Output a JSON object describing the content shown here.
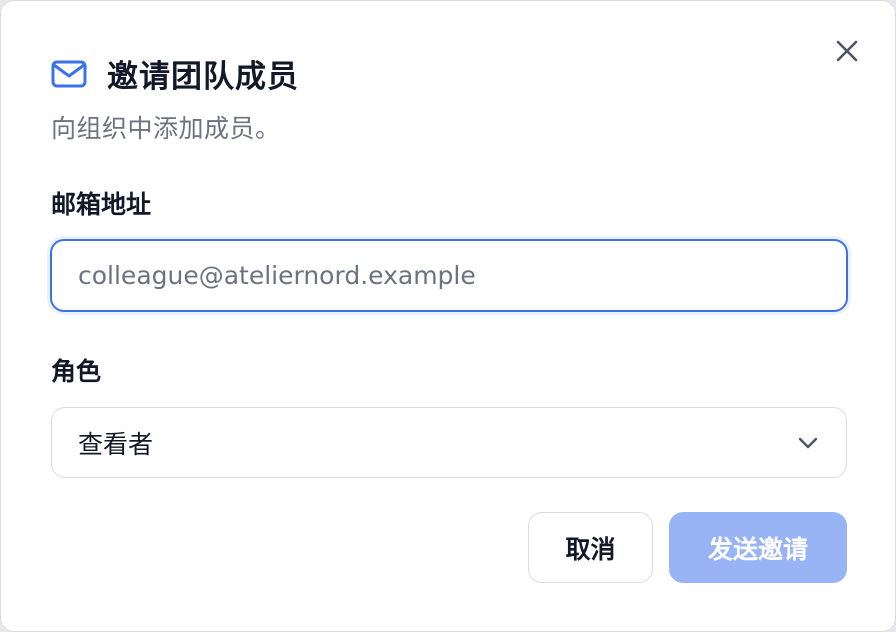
{
  "dialog": {
    "title": "邀请团队成员",
    "subtitle": "向组织中添加成员。",
    "title_icon": "mail-icon",
    "close_icon": "close-icon"
  },
  "email_field": {
    "label": "邮箱地址",
    "placeholder": "colleague@ateliernord.example",
    "value": ""
  },
  "role_field": {
    "label": "角色",
    "selected": "查看者",
    "icon": "chevron-down-icon"
  },
  "actions": {
    "cancel_label": "取消",
    "send_label": "发送邀请",
    "send_enabled": false
  },
  "colors": {
    "accent": "#3b72e6",
    "primary_disabled": "#98b4f5",
    "text": "#111827",
    "muted": "#6b7280",
    "border": "#d9dde3"
  }
}
